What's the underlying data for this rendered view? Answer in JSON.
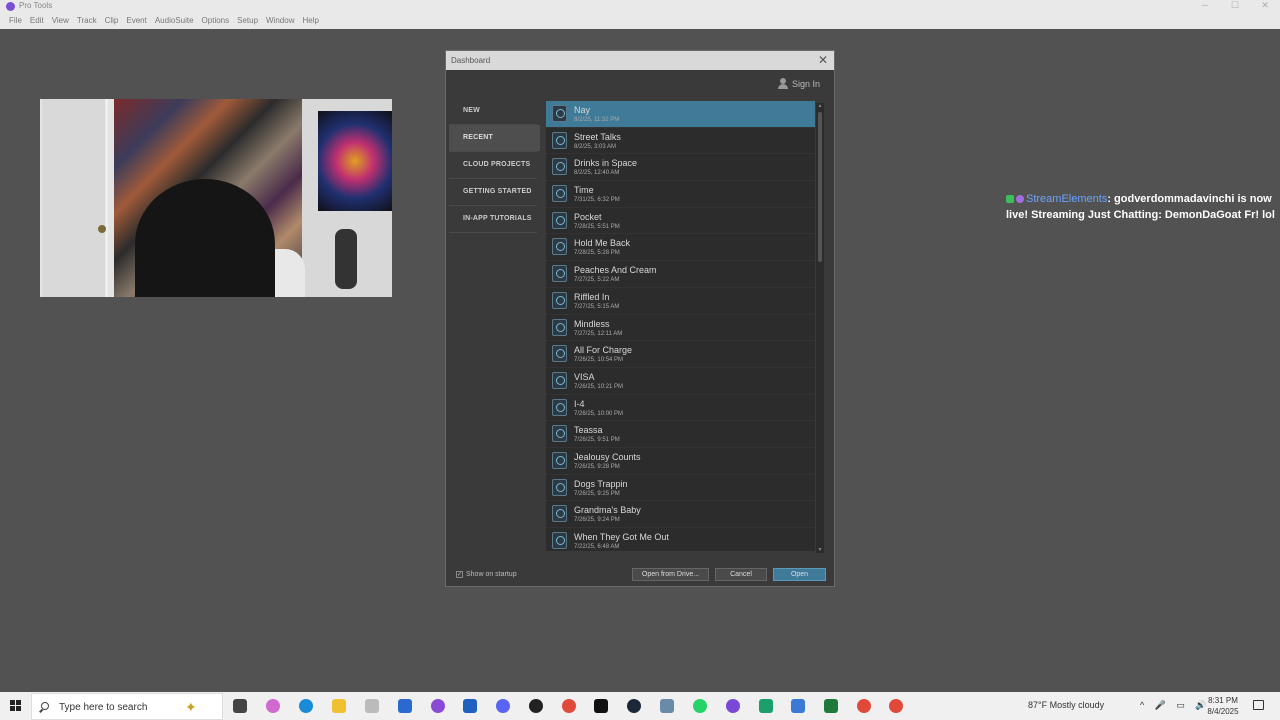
{
  "window": {
    "title": "Pro Tools"
  },
  "menu": [
    "File",
    "Edit",
    "View",
    "Track",
    "Clip",
    "Event",
    "AudioSuite",
    "Options",
    "Setup",
    "Window",
    "Help"
  ],
  "dashboard": {
    "title": "Dashboard",
    "sign_in": "Sign In",
    "nav": [
      "NEW",
      "RECENT",
      "CLOUD PROJECTS",
      "GETTING STARTED",
      "IN-APP TUTORIALS"
    ],
    "active_nav": "RECENT",
    "sessions": [
      {
        "name": "Nay",
        "date": "8/2/25, 11:32 PM"
      },
      {
        "name": "Street Talks",
        "date": "8/2/25, 3:03 AM"
      },
      {
        "name": "Drinks in Space",
        "date": "8/2/25, 12:40 AM"
      },
      {
        "name": "Time",
        "date": "7/31/25, 6:32 PM"
      },
      {
        "name": "Pocket",
        "date": "7/28/25, 5:51 PM"
      },
      {
        "name": "Hold Me Back",
        "date": "7/28/25, 5:28 PM"
      },
      {
        "name": "Peaches And Cream",
        "date": "7/27/25, 5:22 AM"
      },
      {
        "name": "Riffled In",
        "date": "7/27/25, 5:15 AM"
      },
      {
        "name": "Mindless",
        "date": "7/27/25, 12:11 AM"
      },
      {
        "name": "All For Charge",
        "date": "7/26/25, 10:54 PM"
      },
      {
        "name": "VISA",
        "date": "7/26/25, 10:21 PM"
      },
      {
        "name": "I-4",
        "date": "7/26/25, 10:00 PM"
      },
      {
        "name": "Teassa",
        "date": "7/26/25, 9:51 PM"
      },
      {
        "name": "Jealousy Counts",
        "date": "7/26/25, 9:28 PM"
      },
      {
        "name": "Dogs Trappin",
        "date": "7/26/25, 9:25 PM"
      },
      {
        "name": "Grandma's Baby",
        "date": "7/26/25, 9:24 PM"
      },
      {
        "name": "When They Got Me Out",
        "date": "7/22/25, 6:48 AM"
      }
    ],
    "show_on_startup": "Show on startup",
    "buttons": {
      "drive": "Open from Drive...",
      "cancel": "Cancel",
      "open": "Open"
    }
  },
  "chat": {
    "user": "StreamElements",
    "message": ": godverdommadavinchi is now live! Streaming Just Chatting: DemonDaGoat Fr! lol"
  },
  "taskbar": {
    "search_placeholder": "Type here to search",
    "weather": "87°F  Mostly cloudy",
    "time": "8:31 PM",
    "date": "8/4/2025"
  }
}
